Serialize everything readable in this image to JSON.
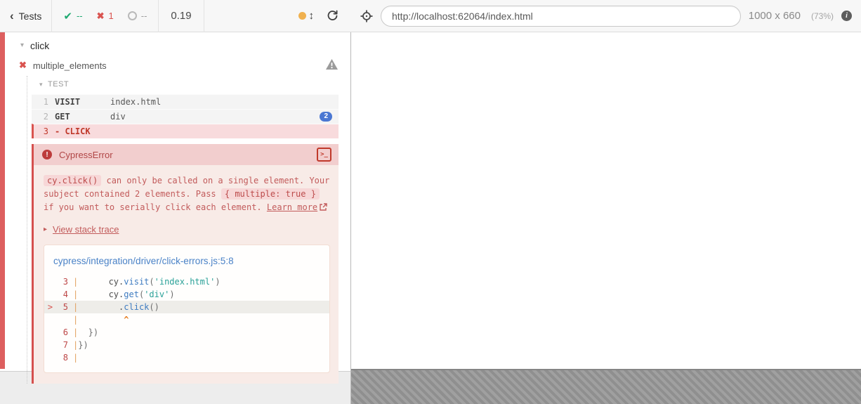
{
  "colors": {
    "pass_green": "#1fa971",
    "fail_red": "#d9534f",
    "error_text": "#c25b5b",
    "badge_blue": "#4a77d2",
    "scroll_orange": "#f0b14f",
    "link_blue": "#4a82c7",
    "caret_orange": "#e67e22",
    "string_teal": "#2aa198",
    "fail_strip": "#dd5f5f"
  },
  "icons": {
    "back_chevron": "‹",
    "check": "✔",
    "fail_x": "✖",
    "updown_arrows": "↕",
    "caret_down": "▾",
    "caret_right": "▸",
    "info": "i",
    "error_bang": "!",
    "console_prompt": ">_"
  },
  "header": {
    "back_label": "Tests",
    "stats": {
      "passed": "--",
      "failed": "1",
      "pending": "--"
    },
    "duration": "0.19",
    "url": "http://localhost:62064/index.html",
    "viewport_size": "1000 x 660",
    "viewport_scale": "(73%)"
  },
  "reporter": {
    "suite_title": "click",
    "test_title": "multiple_elements",
    "attempt_label": "TEST",
    "commands": [
      {
        "num": "1",
        "name": "VISIT",
        "message": "index.html",
        "state": "passed",
        "badge": ""
      },
      {
        "num": "2",
        "name": "GET",
        "message": "div",
        "state": "passed",
        "badge": "2"
      },
      {
        "num": "3",
        "name": "- CLICK",
        "message": "",
        "state": "failed",
        "badge": ""
      }
    ],
    "error": {
      "title": "CypressError",
      "message_segments": [
        {
          "type": "code",
          "text": "cy.click()"
        },
        {
          "type": "text",
          "text": " can only be called on a single element. Your subject contained 2 elements. Pass "
        },
        {
          "type": "code",
          "text": "{ multiple: true }"
        },
        {
          "type": "text",
          "text": " if you want to serially click each element. "
        },
        {
          "type": "link",
          "text": "Learn more"
        }
      ],
      "stack_toggle_label": "View stack trace",
      "code_frame": {
        "file": "cypress/integration/driver/click-errors.js:5:8",
        "lines": [
          {
            "num": "3",
            "marker": "",
            "highlight": false,
            "tokens": [
              [
                "plain",
                "      cy."
              ],
              [
                "method",
                "visit"
              ],
              [
                "punc",
                "("
              ],
              [
                "string",
                "'index.html'"
              ],
              [
                "punc",
                ")"
              ]
            ]
          },
          {
            "num": "4",
            "marker": "",
            "highlight": false,
            "tokens": [
              [
                "plain",
                "      cy."
              ],
              [
                "method",
                "get"
              ],
              [
                "punc",
                "("
              ],
              [
                "string",
                "'div'"
              ],
              [
                "punc",
                ")"
              ]
            ]
          },
          {
            "num": "5",
            "marker": ">",
            "highlight": true,
            "tokens": [
              [
                "plain",
                "        ."
              ],
              [
                "method",
                "click"
              ],
              [
                "punc",
                "()"
              ]
            ]
          },
          {
            "num": "",
            "marker": "",
            "highlight": false,
            "tokens": [
              [
                "caret",
                "         ^"
              ]
            ]
          },
          {
            "num": "6",
            "marker": "",
            "highlight": false,
            "tokens": [
              [
                "punc",
                "  })"
              ]
            ]
          },
          {
            "num": "7",
            "marker": "",
            "highlight": false,
            "tokens": [
              [
                "punc",
                "})"
              ]
            ]
          },
          {
            "num": "8",
            "marker": "",
            "highlight": false,
            "tokens": []
          }
        ]
      }
    }
  }
}
